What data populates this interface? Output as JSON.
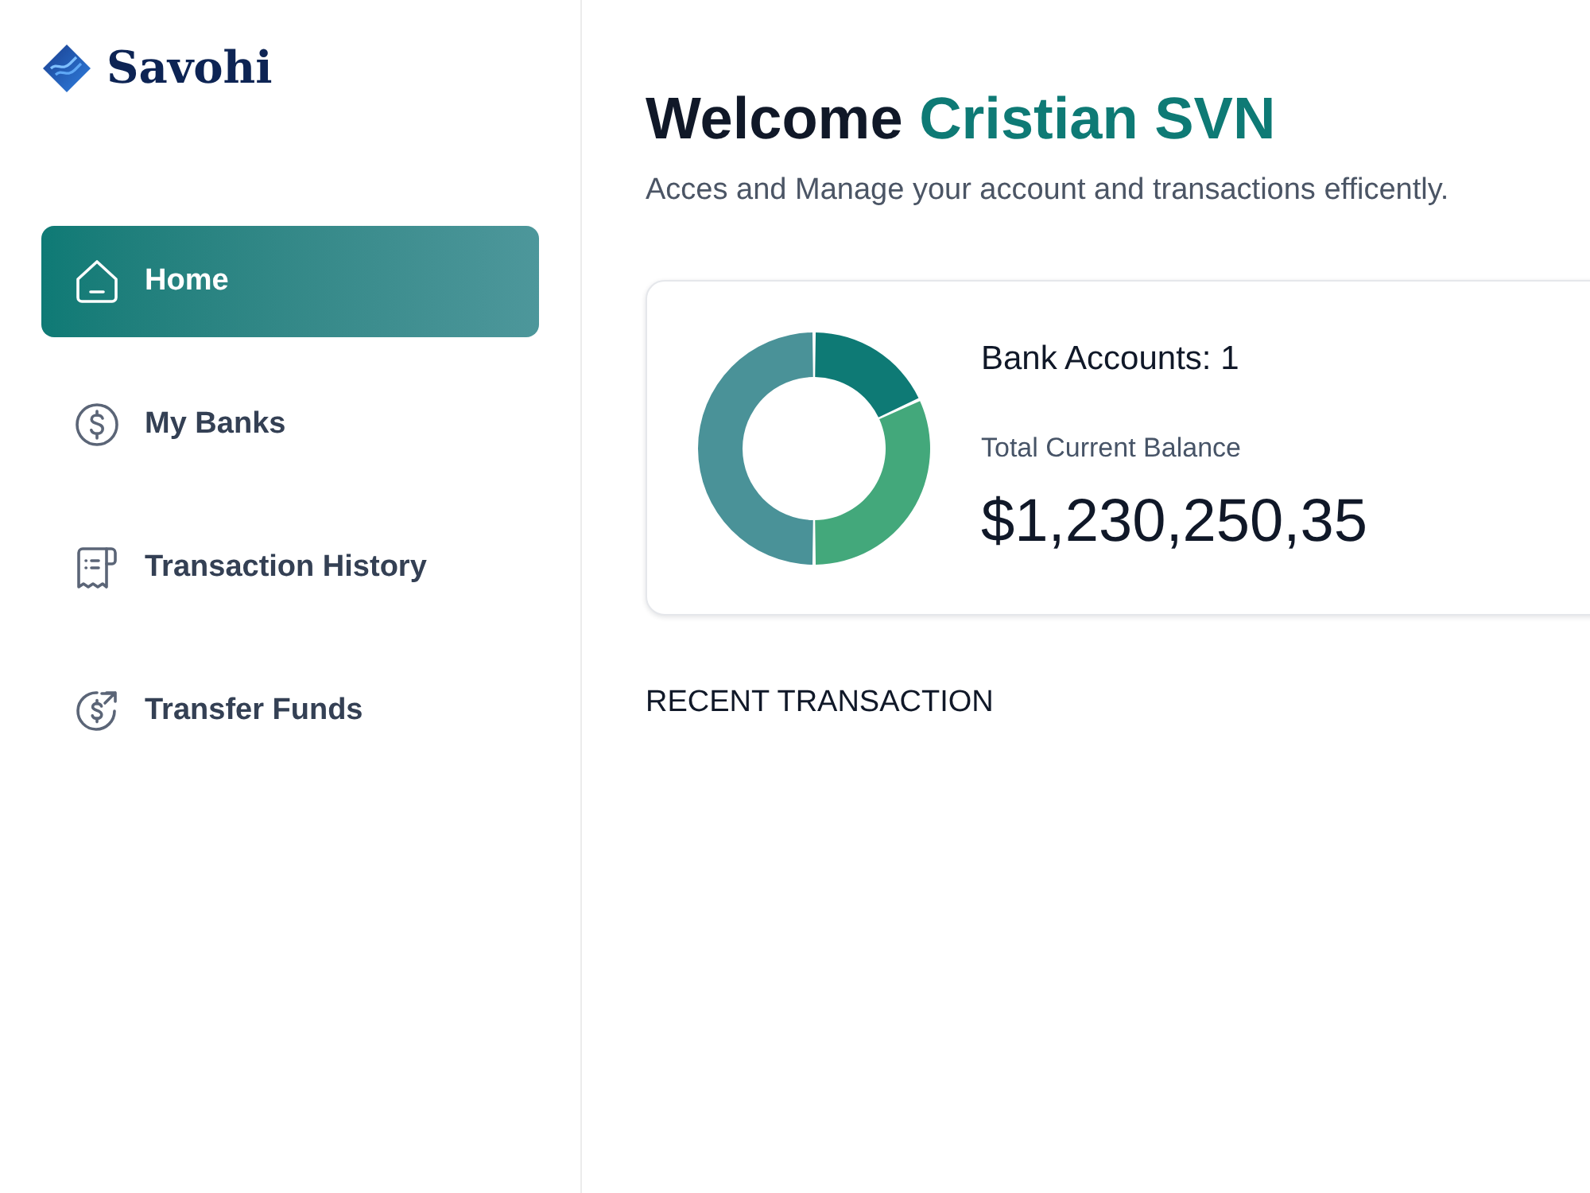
{
  "sidebar": {
    "logo": {
      "text": "Savohi"
    },
    "nav_items": [
      {
        "kind": "home",
        "label": "Home",
        "selected": true
      },
      {
        "kind": "banks",
        "label": "My Banks",
        "selected": false
      },
      {
        "kind": "history",
        "label": "Transaction History",
        "selected": false
      },
      {
        "kind": "transfer",
        "label": "Transfer Funds",
        "selected": false
      }
    ]
  },
  "header": {
    "greeting": "Welcome",
    "user_name": "Cristian SVN",
    "subtitle": "Acces and Manage your account and transactions efficently."
  },
  "balance_card": {
    "bank_accounts": "Bank Accounts: 1",
    "balance_label": "Total Current Balance",
    "balance_amount": "$1,230,250,35"
  },
  "recent_transactions": {
    "title": "RECENT TRANSACTION"
  }
}
